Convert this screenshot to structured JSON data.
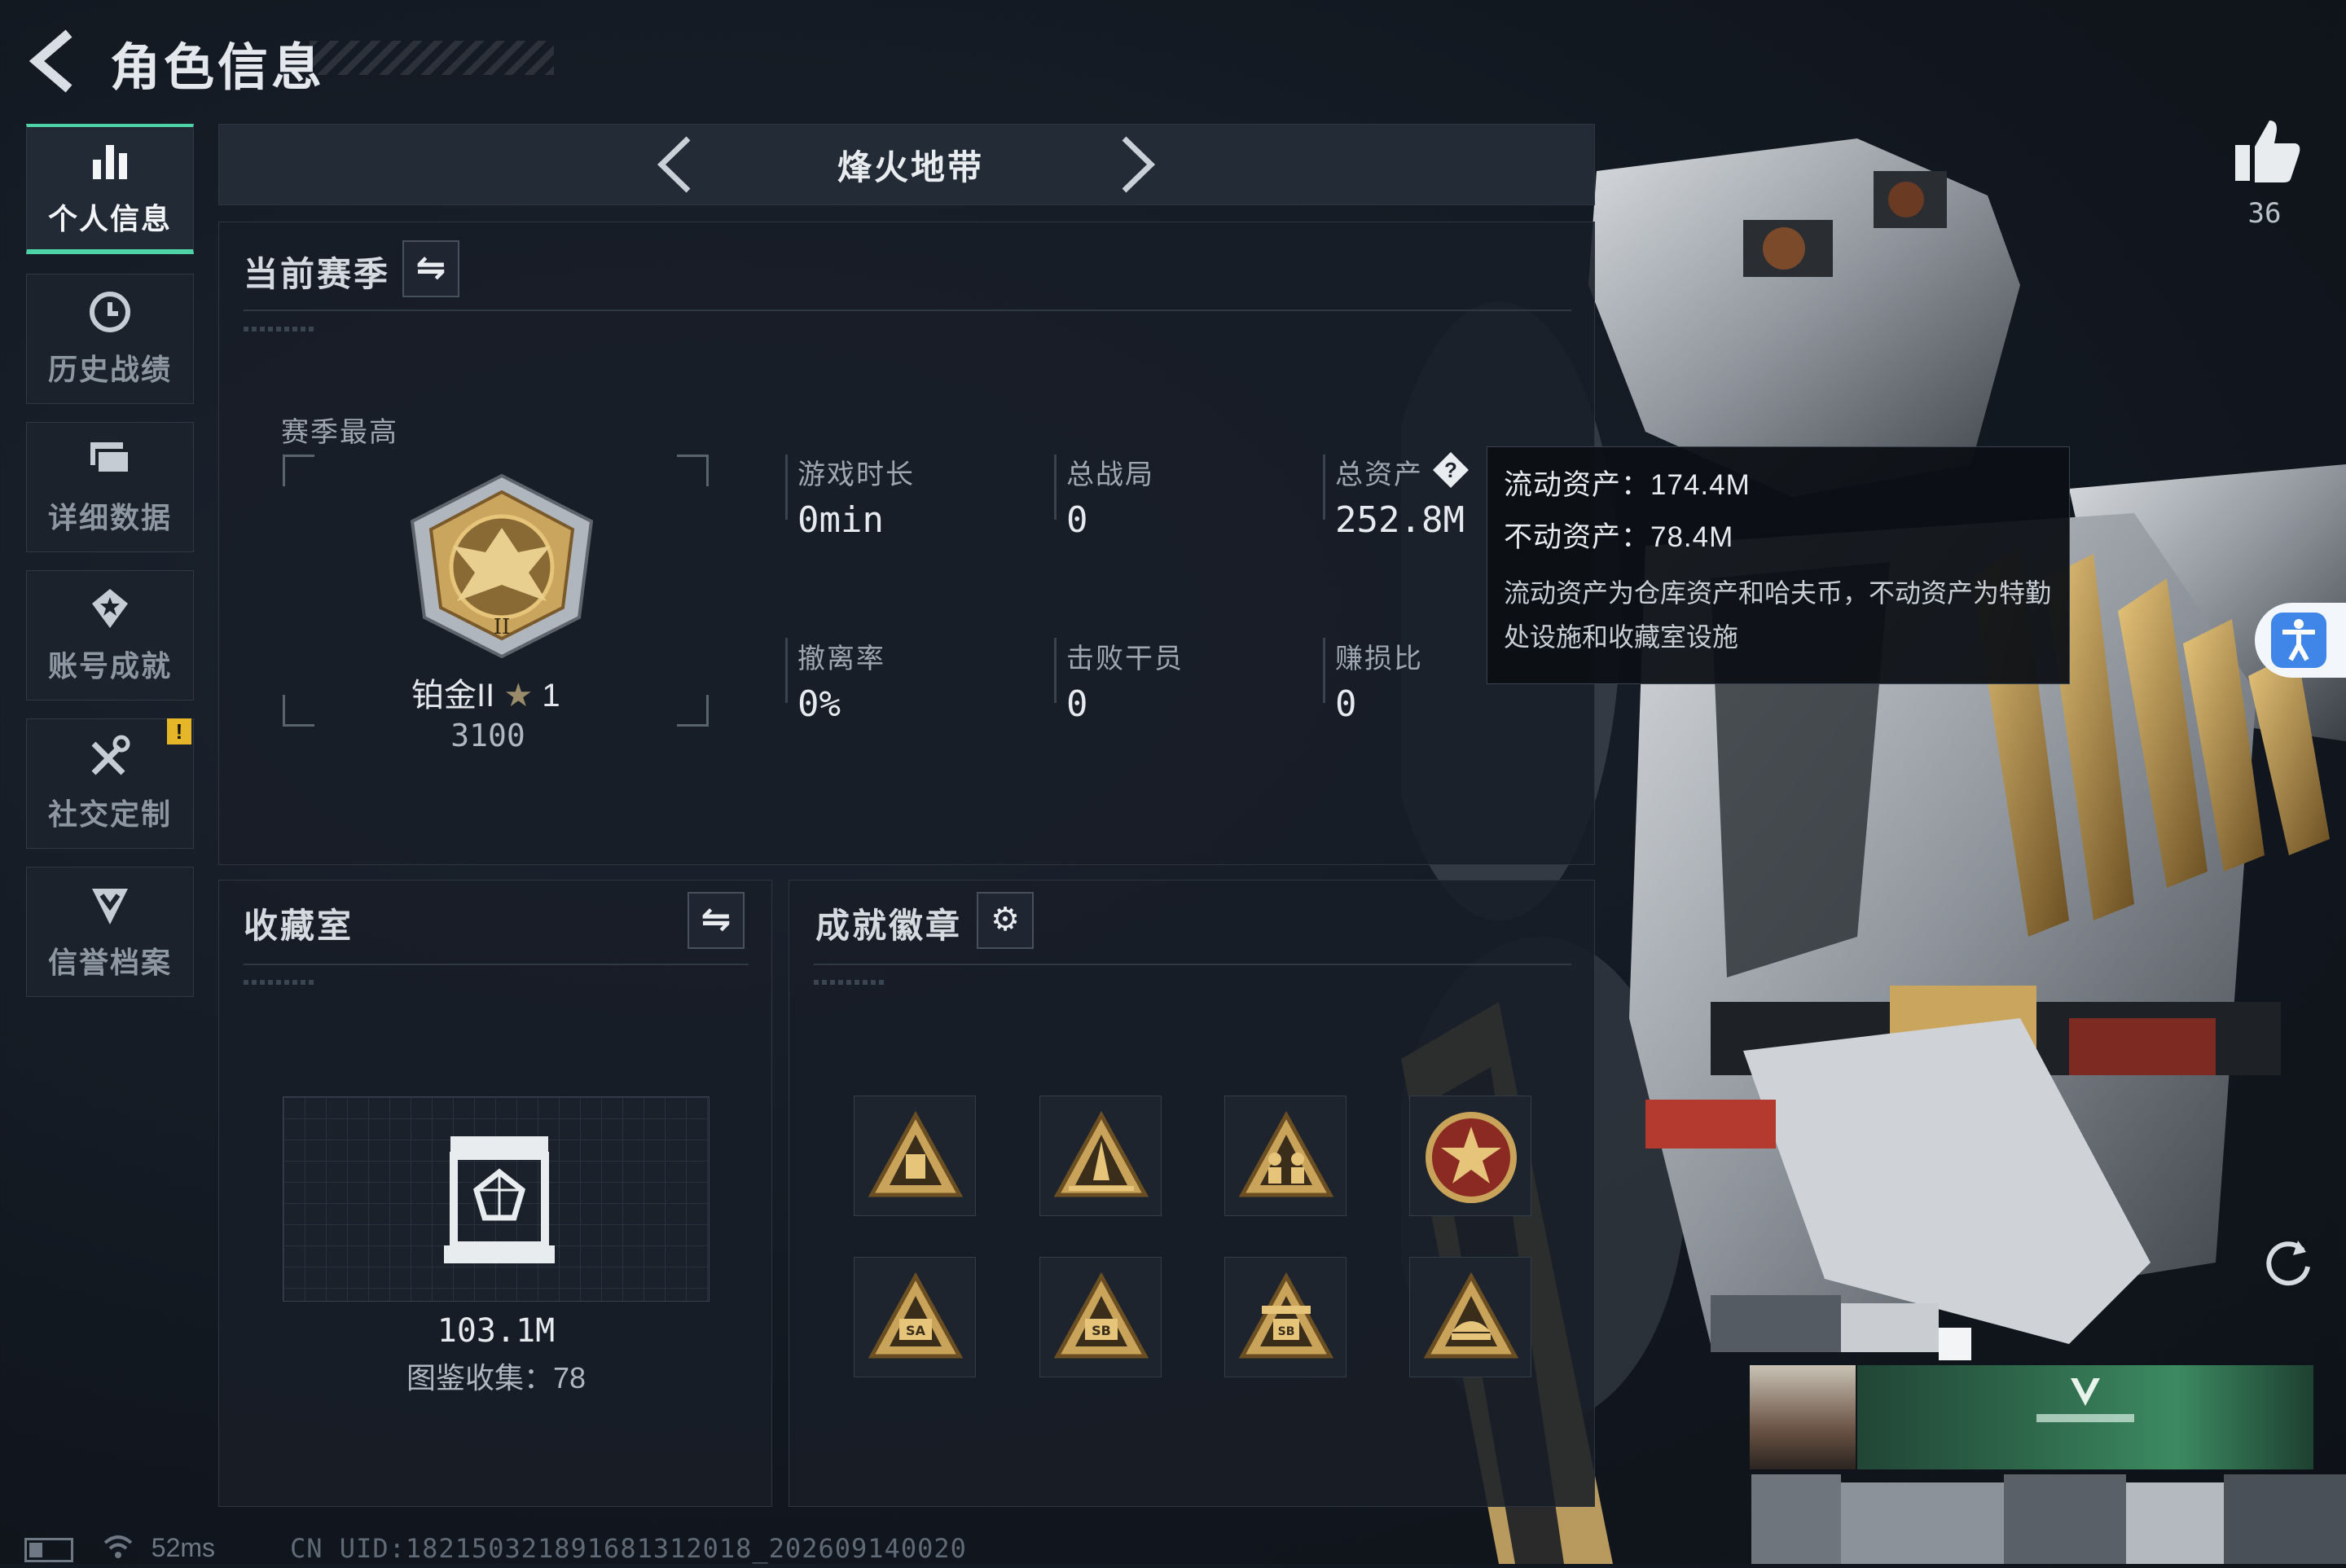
{
  "header": {
    "title": "角色信息",
    "back_icon": "back-arrow-icon"
  },
  "sidebar": {
    "items": [
      {
        "label": "个人信息",
        "icon": "bar-chart-icon",
        "active": true
      },
      {
        "label": "历史战绩",
        "icon": "clock-history-icon",
        "active": false
      },
      {
        "label": "详细数据",
        "icon": "stacked-cards-icon",
        "active": false
      },
      {
        "label": "账号成就",
        "icon": "achievement-star-icon",
        "active": false
      },
      {
        "label": "社交定制",
        "icon": "tools-icon",
        "active": false,
        "badge": "!"
      },
      {
        "label": "信誉档案",
        "icon": "shield-chevron-icon",
        "active": false
      }
    ]
  },
  "mode_selector": {
    "title": "烽火地带"
  },
  "season": {
    "title": "当前赛季",
    "peak_label": "赛季最高",
    "rank_name": "铂金II",
    "rank_star": "★",
    "rank_stars_count": "1",
    "rank_points": "3100",
    "stats": {
      "play_time": {
        "label": "游戏时长",
        "value": "0min"
      },
      "total_matches": {
        "label": "总战局",
        "value": "0"
      },
      "total_assets": {
        "label": "总资产",
        "value": "252.8M",
        "help": "?"
      },
      "extract_rate": {
        "label": "撤离率",
        "value": "0%"
      },
      "kills": {
        "label": "击败干员",
        "value": "0"
      },
      "profit_ratio": {
        "label": "赚损比",
        "value": "0"
      }
    }
  },
  "tooltip": {
    "liquid": "流动资产：174.4M",
    "fixed": "不动资产：78.4M",
    "description": "流动资产为仓库资产和哈夫币，不动资产为特勤处设施和收藏室设施"
  },
  "collection": {
    "title": "收藏室",
    "value": "103.1M",
    "catalog": "图鉴收集：78"
  },
  "achievements": {
    "title": "成就徽章",
    "badges": [
      "gold-triangle-badge",
      "rocket-triangle-badge",
      "figures-triangle-badge",
      "star-round-badge",
      "sa-triangle-badge",
      "sb-triangle-badge",
      "sc-triangle-badge",
      "ship-triangle-badge"
    ]
  },
  "likes": {
    "count": "36",
    "icon": "thumbs-up-icon"
  },
  "status": {
    "ping": "52ms",
    "uid": "CN UID:182150321891681312018_202609140020"
  },
  "colors": {
    "accent": "#4fd2a6",
    "warning": "#e4b628",
    "gold": "#c9a35a",
    "panel_bg": "#18202a"
  }
}
